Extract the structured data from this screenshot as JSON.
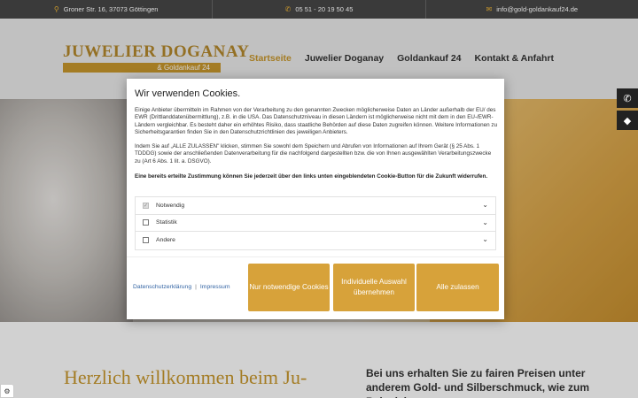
{
  "topbar": {
    "address": "Groner Str. 16, 37073 Göttingen",
    "phone": "05 51 - 20 19 50 45",
    "email": "info@gold-goldankauf24.de",
    "address_icon": "map-pin-icon",
    "phone_icon": "phone-icon",
    "email_icon": "envelope-icon"
  },
  "logo": {
    "main": "JUWELIER DOGANAY",
    "sub": "& Goldankauf 24"
  },
  "nav": [
    {
      "label": "Startseite",
      "active": true
    },
    {
      "label": "Juwelier Doganay"
    },
    {
      "label": "Goldankauf 24"
    },
    {
      "label": "Kontakt & Anfahrt"
    }
  ],
  "welcome": {
    "heading": "Herzlich willkommen beim Ju-",
    "side_text": "Bei uns erhalten Sie zu fairen Preisen unter anderem Gold- und Silberschmuck, wie zum Beispiel"
  },
  "cookie": {
    "title": "Wir verwenden Cookies.",
    "text1": "Einige Anbieter übermitteln im Rahmen von der Verarbeitung zu den genannten Zwecken möglicherweise Daten an Länder außerhalb der EU/ des EWR (Drittlanddatenübermittlung), z.B. in die USA. Das Datenschutzniveau in diesen Ländern ist möglicherweise nicht mit dem in den EU-/EWR-Ländern vergleichbar. Es besteht daher ein erhöhtes Risiko, dass staatliche Behörden auf diese Daten zugreifen können. Weitere Informationen zu Sicherheitsgarantien finden Sie in den Datenschutzrichtlinien des jeweiligen Anbieters.",
    "text2": "Indem Sie auf „ALLE ZULASSEN\" klicken, stimmen Sie sowohl dem Speichern und Abrufen von Informationen auf Ihrem Gerät (§ 25 Abs. 1 TDDDG) sowie der anschließenden Datenverarbeitung für die nachfolgend dargestellten bzw. die von Ihnen ausgewählten Verarbeitungszwecke zu (Art 6 Abs. 1 lit. a. DSGVO).",
    "text3": "Eine bereits erteilte Zustimmung können Sie jederzeit über den links unten eingeblendeten Cookie-Button für die Zukunft widerrufen.",
    "categories": [
      {
        "label": "Notwendig",
        "checked": true
      },
      {
        "label": "Statistik",
        "checked": false
      },
      {
        "label": "Andere",
        "checked": false
      }
    ],
    "privacy_link": "Datenschutzerklärung",
    "separator": "|",
    "imprint_link": "Impressum",
    "btn_necessary": "Nur notwendige Cookies",
    "btn_individual": "Individuelle Auswahl übernehmen",
    "btn_all": "Alle zulassen"
  },
  "colors": {
    "accent": "#c9982c",
    "button": "#d7a23a",
    "topbar": "#3a3a3a"
  }
}
